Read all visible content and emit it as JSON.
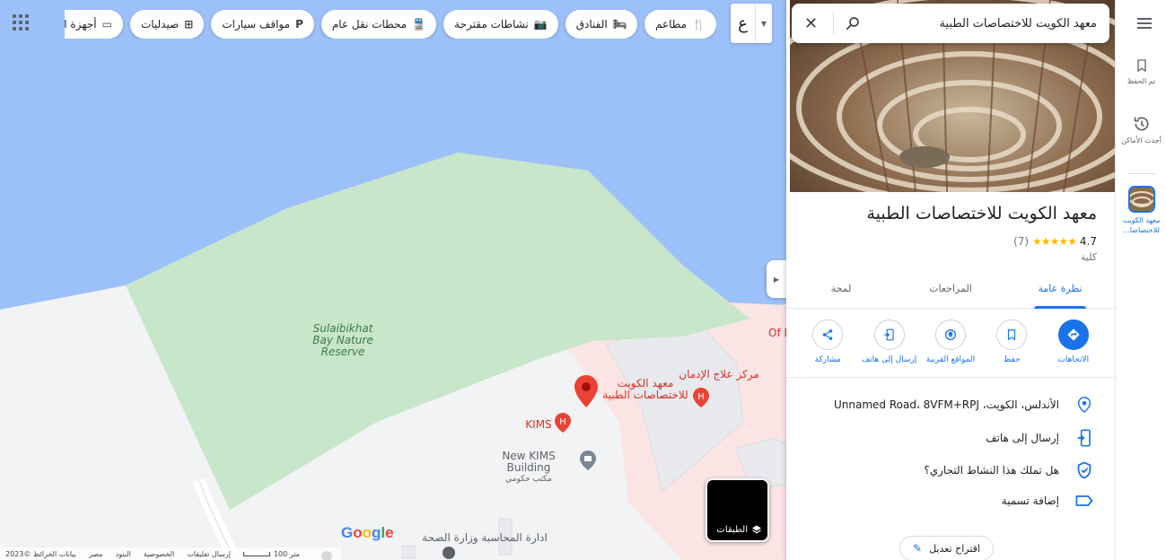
{
  "map": {
    "chips": [
      {
        "icon": "restaurant-icon",
        "label": "مطاعم"
      },
      {
        "icon": "hotel-icon",
        "label": "الفنادق"
      },
      {
        "icon": "camera-icon",
        "label": "نشاطات مقترحة"
      },
      {
        "icon": "train-icon",
        "label": "محطات نقل عام"
      },
      {
        "icon": "parking-icon",
        "label": "مواقف سيارات"
      },
      {
        "icon": "pharmacy-icon",
        "label": "صيدليات"
      },
      {
        "icon": "atm-icon",
        "label": "أجهزة الصراف الآلي"
      }
    ],
    "language_letter": "ع",
    "labels": {
      "reserve_line1": "Sulaibikhat",
      "reserve_line2": "Bay Nature",
      "reserve_line3": "Reserve",
      "place_line1": "معهد الكويت",
      "place_line2": "للاختصاصات الطبية",
      "addiction_center": "مركز علاج الإدمان",
      "kims": "KIMS",
      "new_kims": "New KIMS Building",
      "gov_office": "مكتب حكومي",
      "accounting_line1": "ادارة المحاسبة وزارة الصحة",
      "cut_text": "Of M"
    },
    "footer": {
      "data": "بيانات الخرائط ©2023",
      "country": "مصر",
      "terms": "البنود",
      "privacy": "الخصوصية",
      "feedback": "إرسال تعليقات",
      "scale": "100 متر"
    },
    "layers_label": "الطبقات"
  },
  "panel": {
    "search_query": "معهد الكويت للاختصاصات الطبية",
    "title": "معهد الكويت للاختصاصات الطبية",
    "rating": "4.7",
    "stars": "★★★★★",
    "review_count": "(7)",
    "category": "كلية",
    "tabs": [
      "نظرة عامة",
      "المراجعات",
      "لمحة"
    ],
    "actions": [
      "الاتجاهات",
      "حفظ",
      "المواقع القريبة",
      "إرسال إلى هاتف",
      "مشاركة"
    ],
    "address": "الأندلس، الكويت، Unnamed Road، 8VFM+RPJ",
    "send_to_phone": "إرسال إلى هاتف",
    "claim_business": "هل تملك هذا النشاط التجاري؟",
    "add_label": "إضافة تسمية",
    "suggest_edit": "اقتراح تعديل"
  },
  "rail": {
    "saved": "تم الحفظ",
    "recent": "أحدث الأماكن",
    "active_place": "معهد الكويت للاختصاصا..."
  },
  "colors": {
    "water": "#9cc0f9",
    "park": "#c8e6c9",
    "accent": "#1a73e8",
    "pin": "#ea4335"
  }
}
